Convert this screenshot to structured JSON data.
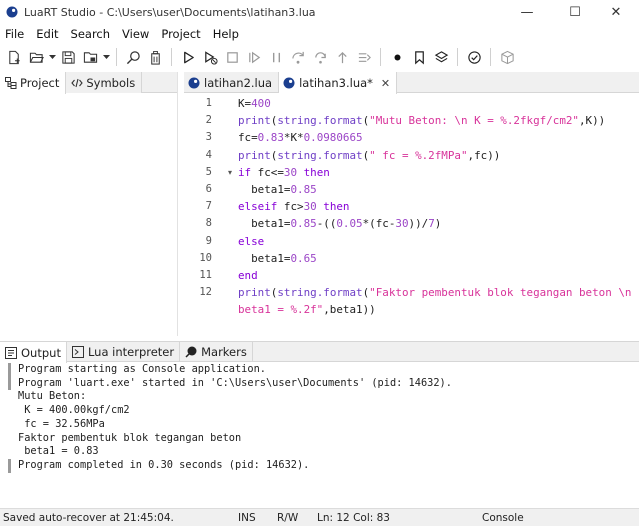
{
  "window": {
    "title": "LuaRT Studio - C:\\Users\\user\\Documents\\latihan3.lua",
    "min": "—",
    "max": "☐",
    "close": "✕"
  },
  "menu": [
    "File",
    "Edit",
    "Search",
    "View",
    "Project",
    "Help"
  ],
  "toolbar": {
    "icons": [
      "new-file-icon",
      "open-folder-icon",
      "save-icon",
      "project-folder-icon",
      "search-icon",
      "clear-icon",
      "run-icon",
      "debug-icon",
      "stop-icon",
      "step-icon",
      "pause-icon",
      "step-over-icon",
      "step-into-icon",
      "step-out-icon",
      "watch-icon",
      "breakpoint-icon",
      "bookmark-icon",
      "layers-icon",
      "check-icon",
      "package-icon"
    ]
  },
  "left_panel": {
    "tabs": [
      {
        "label": "Project",
        "active": true
      },
      {
        "label": "Symbols",
        "active": false
      }
    ]
  },
  "editor": {
    "tabs": [
      {
        "label": "latihan2.lua",
        "active": false
      },
      {
        "label": "latihan3.lua*",
        "active": true,
        "close": "✕"
      }
    ],
    "line_numbers": [
      "1",
      "2",
      "3",
      "4",
      "5",
      "6",
      "7",
      "8",
      "9",
      "10",
      "11",
      "12"
    ],
    "fold_marker": "▾",
    "code": [
      {
        "parts": [
          [
            "var",
            "K="
          ],
          [
            "num",
            "400"
          ]
        ]
      },
      {
        "parts": [
          [
            "fn",
            "print"
          ],
          [
            "var",
            "("
          ],
          [
            "fn",
            "string.format"
          ],
          [
            "var",
            "("
          ],
          [
            "str",
            "\"Mutu Beton: \\n K = %.2fkgf/cm2\""
          ],
          [
            "var",
            ",K))"
          ]
        ]
      },
      {
        "parts": [
          [
            "var",
            "fc="
          ],
          [
            "num",
            "0.83"
          ],
          [
            "var",
            "*K*"
          ],
          [
            "num",
            "0.0980665"
          ]
        ]
      },
      {
        "parts": [
          [
            "fn",
            "print"
          ],
          [
            "var",
            "("
          ],
          [
            "fn",
            "string.format"
          ],
          [
            "var",
            "("
          ],
          [
            "str",
            "\" fc = %.2fMPa\""
          ],
          [
            "var",
            ",fc))"
          ]
        ]
      },
      {
        "parts": [
          [
            "kw",
            "if"
          ],
          [
            "var",
            " fc<="
          ],
          [
            "num",
            "30"
          ],
          [
            "var",
            " "
          ],
          [
            "kw",
            "then"
          ]
        ]
      },
      {
        "parts": [
          [
            "var",
            "  beta1="
          ],
          [
            "num",
            "0.85"
          ]
        ]
      },
      {
        "parts": [
          [
            "kw",
            "elseif"
          ],
          [
            "var",
            " fc>"
          ],
          [
            "num",
            "30"
          ],
          [
            "var",
            " "
          ],
          [
            "kw",
            "then"
          ]
        ]
      },
      {
        "parts": [
          [
            "var",
            "  beta1="
          ],
          [
            "num",
            "0.85"
          ],
          [
            "var",
            "-(("
          ],
          [
            "num",
            "0.05"
          ],
          [
            "var",
            "*(fc-"
          ],
          [
            "num",
            "30"
          ],
          [
            "var",
            "))/"
          ],
          [
            "num",
            "7"
          ],
          [
            "var",
            ")"
          ]
        ]
      },
      {
        "parts": [
          [
            "kw",
            "else"
          ]
        ]
      },
      {
        "parts": [
          [
            "var",
            "  beta1="
          ],
          [
            "num",
            "0.65"
          ]
        ]
      },
      {
        "parts": [
          [
            "kw",
            "end"
          ]
        ]
      },
      {
        "parts": [
          [
            "fn",
            "print"
          ],
          [
            "var",
            "("
          ],
          [
            "fn",
            "string.format"
          ],
          [
            "var",
            "("
          ],
          [
            "str",
            "\"Faktor pembentuk blok tegangan beton \\n"
          ]
        ]
      },
      {
        "parts": [
          [
            "str",
            "beta1 = %.2f\""
          ],
          [
            "var",
            ",beta1))"
          ]
        ]
      }
    ]
  },
  "bottom_panel": {
    "tabs": [
      {
        "label": "Output",
        "active": true
      },
      {
        "label": "Lua interpreter",
        "active": false
      },
      {
        "label": "Markers",
        "active": false
      }
    ],
    "output": [
      {
        "text": "Program starting as Console application.",
        "mark": true
      },
      {
        "text": "Program 'luart.exe' started in 'C:\\Users\\user\\Documents' (pid: 14632).",
        "mark": true
      },
      {
        "text": "Mutu Beton:",
        "mark": false
      },
      {
        "text": " K = 400.00kgf/cm2",
        "mark": false
      },
      {
        "text": " fc = 32.56MPa",
        "mark": false
      },
      {
        "text": "Faktor pembentuk blok tegangan beton",
        "mark": false
      },
      {
        "text": " beta1 = 0.83",
        "mark": false
      },
      {
        "text": "Program completed in 0.30 seconds (pid: 14632).",
        "mark": true
      }
    ]
  },
  "status": {
    "saved": "Saved auto-recover at 21:45:04.",
    "mode": "INS",
    "access": "R/W",
    "position": "Ln: 12 Col: 83",
    "app_type": "Console"
  }
}
